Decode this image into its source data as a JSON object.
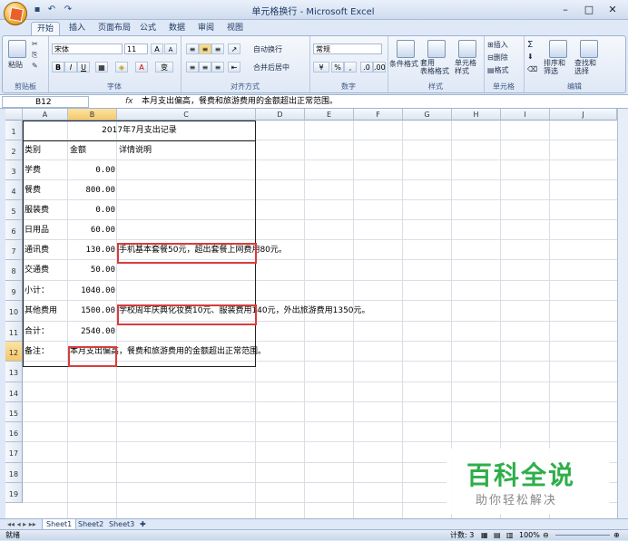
{
  "window": {
    "title": "单元格换行 - Microsoft Excel",
    "min": "–",
    "max": "□",
    "close": "✕"
  },
  "qat": {
    "save": "▪",
    "undo": "↶",
    "redo": "↷"
  },
  "tabs": [
    "开始",
    "插入",
    "页面布局",
    "公式",
    "数据",
    "审阅",
    "视图"
  ],
  "ribbon": {
    "clipboard": {
      "paste": "粘贴",
      "label": "剪贴板"
    },
    "font": {
      "name": "宋体",
      "size": "11",
      "bold": "B",
      "italic": "I",
      "underline": "U",
      "grow": "A",
      "shrink": "A",
      "wen": "变",
      "label": "字体"
    },
    "alignment": {
      "wrap": "自动换行",
      "merge": "合并后居中",
      "label": "对齐方式"
    },
    "number": {
      "format": "常规",
      "percent": "%",
      "comma": ",",
      "label": "数字"
    },
    "styles": {
      "cond": "条件格式",
      "table": "套用\n表格格式",
      "cell": "单元格\n样式",
      "label": "样式"
    },
    "cells": {
      "insert": "插入",
      "delete": "删除",
      "format": "格式",
      "label": "单元格"
    },
    "editing": {
      "sum": "Σ",
      "sort": "排序和\n筛选",
      "find": "查找和\n选择",
      "label": "编辑"
    }
  },
  "formula_bar": {
    "name_box": "B12",
    "fx": "fx",
    "content": "本月支出偏高，餐费和旅游费用的金额超出正常范围。"
  },
  "columns": [
    "A",
    "B",
    "C",
    "D",
    "E",
    "F",
    "G",
    "H",
    "I",
    "J"
  ],
  "rows": [
    "1",
    "2",
    "3",
    "4",
    "5",
    "6",
    "7",
    "8",
    "9",
    "10",
    "11",
    "12",
    "13",
    "14",
    "15",
    "16",
    "17",
    "18",
    "19"
  ],
  "sheet": {
    "title": "2017年7月支出记录",
    "headers": {
      "a": "类别",
      "b": "金额",
      "c": "详情说明"
    },
    "data": [
      {
        "a": "学费",
        "b": "0.00",
        "c": ""
      },
      {
        "a": "餐费",
        "b": "800.00",
        "c": ""
      },
      {
        "a": "服装费",
        "b": "0.00",
        "c": ""
      },
      {
        "a": "日用品",
        "b": "60.00",
        "c": ""
      },
      {
        "a": "通讯费",
        "b": "130.00",
        "c": "手机基本套餐50元，超出套餐上网费用80元。"
      },
      {
        "a": "交通费",
        "b": "50.00",
        "c": ""
      },
      {
        "a": "小计：",
        "b": "1040.00",
        "c": ""
      },
      {
        "a": "其他费用",
        "b": "1500.00",
        "c": "学校周年庆典化妆费10元、服装费用140元，外出旅游费用1350元。"
      },
      {
        "a": "合计：",
        "b": "2540.00",
        "c": ""
      },
      {
        "a": "备注：",
        "b": "本月支出偏高，餐费和旅游费用的金额超出正常范围。",
        "c": ""
      }
    ]
  },
  "sheet_tabs": [
    "Sheet1",
    "Sheet2",
    "Sheet3"
  ],
  "status": {
    "ready": "就绪",
    "count": "计数: 3",
    "zoom": "100%"
  },
  "watermark": {
    "line1": "百科全说",
    "line2": "助你轻松解决"
  },
  "colors": {
    "highlight": "#d93b3b",
    "watermark_green": "#2fae4a",
    "selected_header": "#f4c868"
  }
}
